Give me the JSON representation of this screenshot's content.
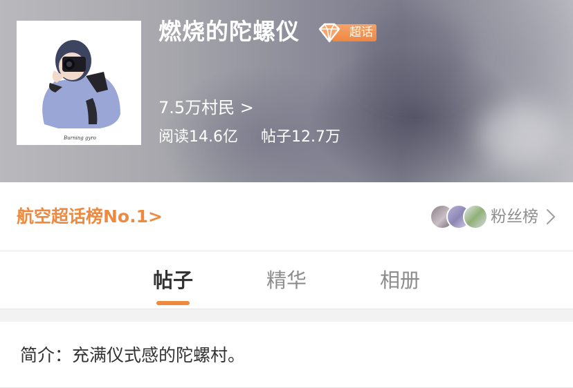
{
  "header": {
    "title": "燃烧的陀螺仪",
    "badge_label": "超话",
    "members": "7.5万村民 >",
    "reads": "阅读14.6亿",
    "posts": "帖子12.7万",
    "avatar_signature": "Burning gyro"
  },
  "rank": {
    "label": "航空超话榜No.1>",
    "fans_label": "粉丝榜"
  },
  "tabs": [
    {
      "label": "帖子",
      "active": true
    },
    {
      "label": "精华",
      "active": false
    },
    {
      "label": "相册",
      "active": false
    }
  ],
  "intro": {
    "text": "简介：充满仪式感的陀螺村。"
  },
  "colors": {
    "accent": "#ee8a3f",
    "badge": "#ef8a45",
    "text_primary": "#333333",
    "text_secondary": "#8c8c8c"
  },
  "icons": [
    "gem-icon",
    "chevron-right-icon"
  ]
}
